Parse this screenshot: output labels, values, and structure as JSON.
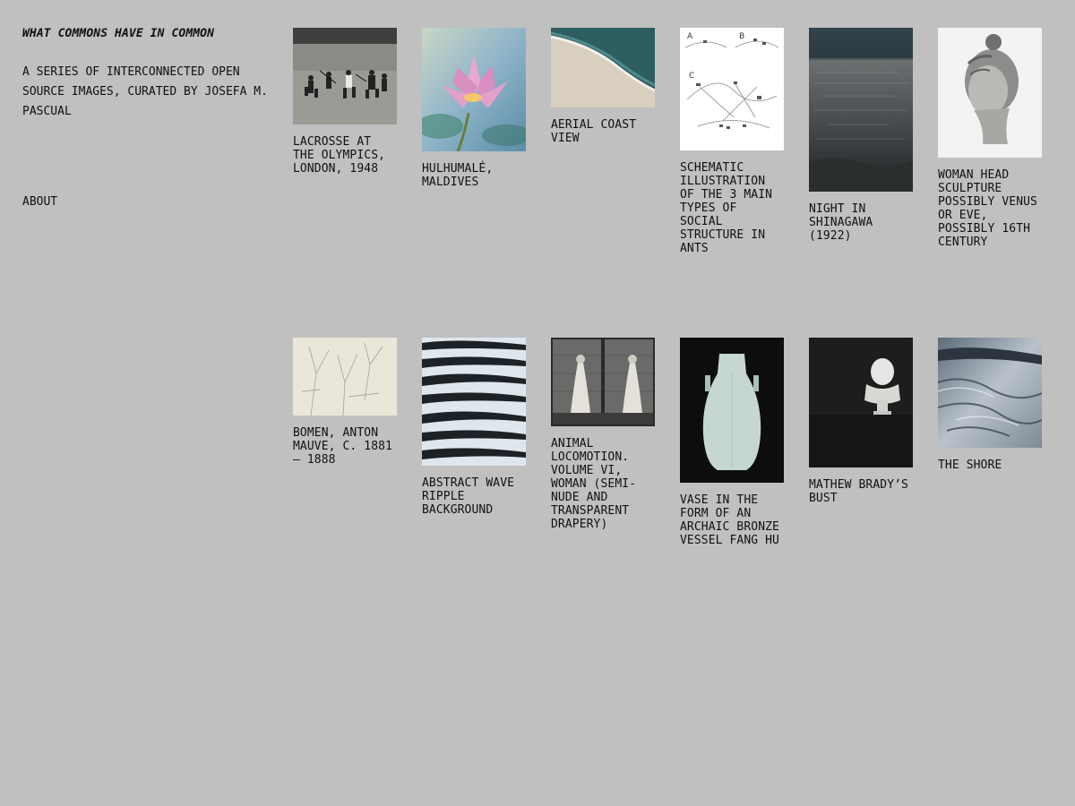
{
  "site": {
    "title": "WHAT COMMONS HAVE IN COMMON",
    "description": "A SERIES OF INTERCONNECTED OPEN SOURCE IMAGES, CURATED BY JOSEFA M. PASCUAL",
    "about_label": "ABOUT"
  },
  "gallery": [
    {
      "caption": "LACROSSE AT THE OLYMPICS, LONDON, 1948",
      "image": "lacrosse-photo"
    },
    {
      "caption": "HULHUMALÉ, MALDIVES",
      "image": "water-lily-photo"
    },
    {
      "caption": "AERIAL COAST VIEW",
      "image": "aerial-coast-photo"
    },
    {
      "caption": "SCHEMATIC ILLUSTRATION OF THE 3 MAIN TYPES OF SOCIAL STRUCTURE IN ANTS",
      "image": "ant-schematic-diagram"
    },
    {
      "caption": "NIGHT IN SHINAGAWA (1922)",
      "image": "night-sea-photo"
    },
    {
      "caption": "WOMAN HEAD SCULPTURE POSSIBLY VENUS OR EVE, POSSIBLY 16TH CENTURY",
      "image": "sculpture-head-photo"
    },
    {
      "caption": "BOMEN, ANTON MAUVE, C. 1881 – 1888",
      "image": "tree-sketch"
    },
    {
      "caption": "ABSTRACT WAVE RIPPLE BACKGROUND",
      "image": "wave-ripple-image"
    },
    {
      "caption": "ANIMAL LOCOMOTION. VOLUME VI, WOMAN (SEMI-NUDE AND TRANSPARENT DRAPERY)",
      "image": "locomotion-photo"
    },
    {
      "caption": "VASE IN THE FORM OF AN ARCHAIC BRONZE VESSEL FANG HU",
      "image": "celadon-vase-photo"
    },
    {
      "caption": "MATHEW BRADY’S BUST",
      "image": "bust-photo"
    },
    {
      "caption": "THE SHORE",
      "image": "shore-photo"
    }
  ],
  "diagram_labels": {
    "a": "A",
    "b": "B",
    "c": "C"
  }
}
